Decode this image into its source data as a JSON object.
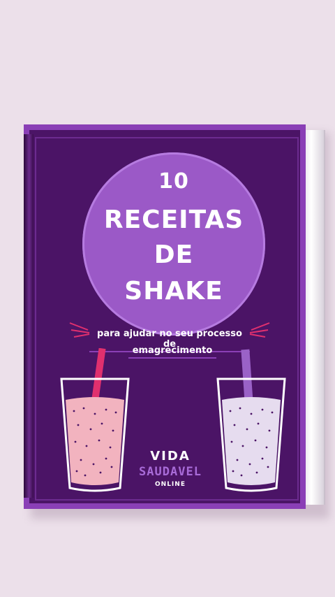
{
  "cover": {
    "title_number": "10",
    "title_line2": "RECEITAS",
    "title_line3": "DE",
    "title_line4": "SHAKE",
    "subtitle_line1": "para ajudar no seu processo de",
    "subtitle_line2": "emagrecimento"
  },
  "brand": {
    "line1": "VIDA",
    "line2": "SAUDAVEL",
    "line3": "ONLINE"
  },
  "colors": {
    "background": "#ece0ea",
    "cover": "#4b1466",
    "circle": "#9b59c7",
    "accent": "#a86bd8",
    "pink_shake": "#f2b3bf",
    "lilac_shake": "#e6dcef",
    "straw_pink": "#e0306e",
    "straw_purple": "#9a62c7"
  },
  "icons": [
    "glass-pink-shake-icon",
    "glass-lilac-shake-icon",
    "decor-lines-icon"
  ]
}
